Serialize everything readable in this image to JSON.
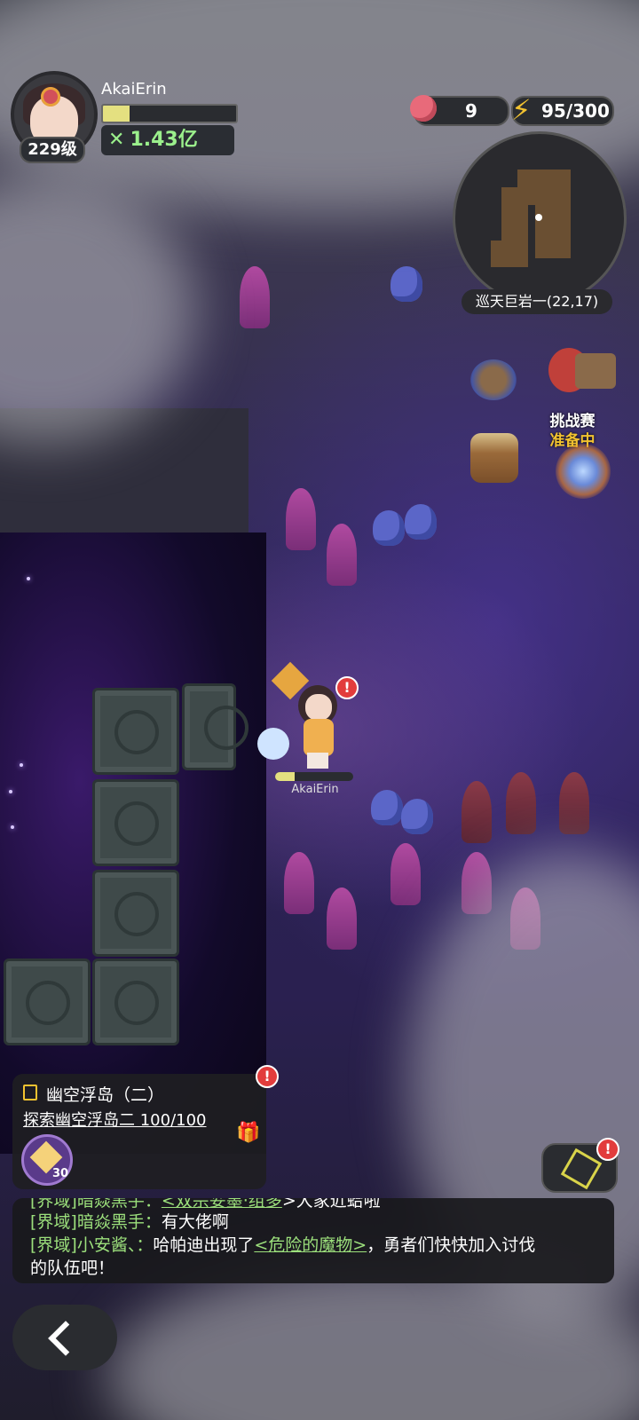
{
  "player": {
    "name": "AkaiErin",
    "level": "229级",
    "power": "1.43亿",
    "xp_progress": 0.2,
    "hp_progress": 0.25
  },
  "resources": {
    "apple_count": "9",
    "energy": "95/300"
  },
  "minimap": {
    "location": "巡天巨岩一(22,17)"
  },
  "challenge": {
    "title": "挑战赛",
    "status": "准备中"
  },
  "quest": {
    "title": "幽空浮岛（二）",
    "desc": "探索幽空浮岛二 100/100",
    "reward_count": "30"
  },
  "chat": {
    "messages": [
      {
        "channel": "[界域]",
        "sender": "暗焱黑手：",
        "text": "<双宗妥墨·组多",
        "tail": ">大家近蛤啦"
      },
      {
        "channel": "[界域]",
        "sender": "暗焱黑手：",
        "text": "有大佬啊"
      },
      {
        "channel": "[界域]",
        "sender": "小安酱、：",
        "text": "哈帕迪出现了",
        "link": "<危险的魔物>",
        "tail": "，勇者们快快加入讨伐"
      },
      {
        "text": "的队伍吧！"
      }
    ]
  },
  "warnings": {
    "mark": "!"
  },
  "colors": {
    "accent_green": "#9ce07c",
    "gold": "#f2c230",
    "alert_red": "#e23c3c"
  }
}
